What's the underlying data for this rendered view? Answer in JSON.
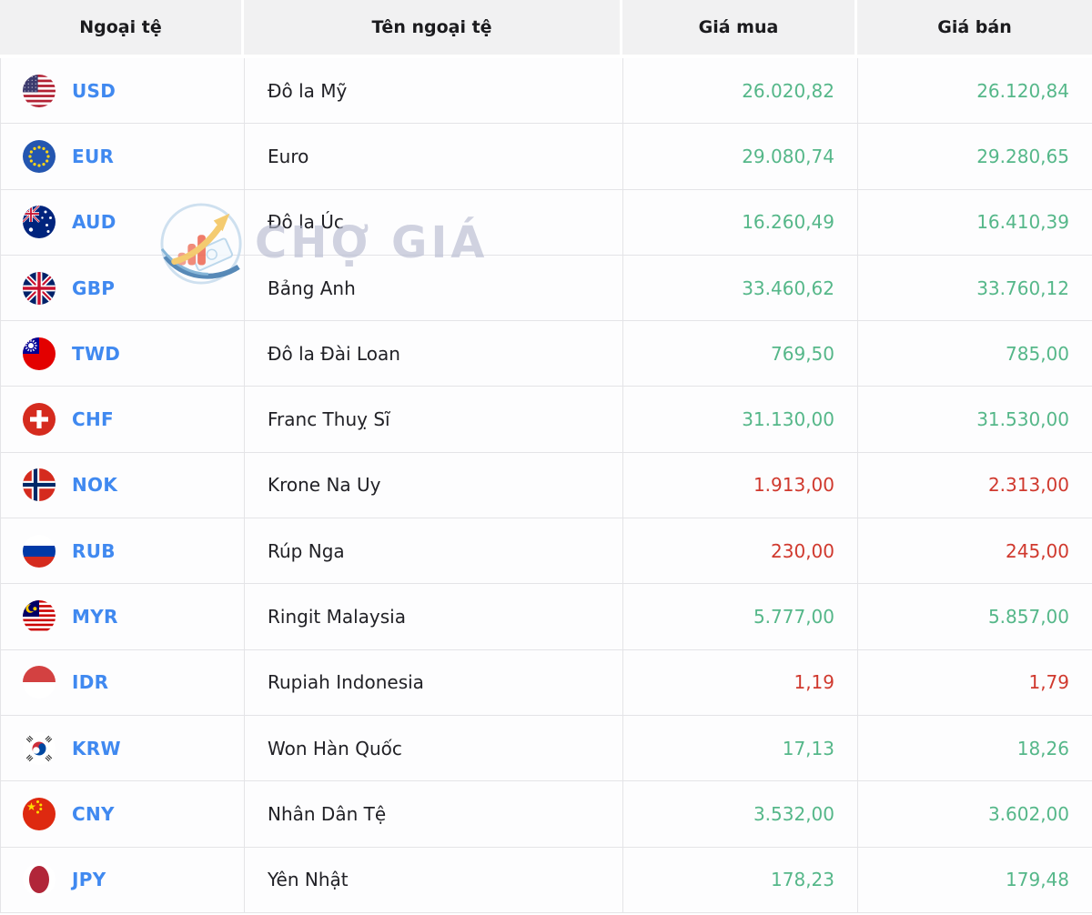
{
  "header": {
    "columns": [
      {
        "label": "Ngoại tệ"
      },
      {
        "label": "Tên ngoại tệ"
      },
      {
        "label": "Giá mua"
      },
      {
        "label": "Giá bán"
      }
    ]
  },
  "watermark": {
    "text": "CHỢ GIÁ",
    "logo_icon": "cho-gia-logo-icon"
  },
  "colors": {
    "header_bg": "#f1f1f2",
    "header_text": "#1b1b1e",
    "row_bg": "#fdfdfe",
    "border": "#e4e4e7",
    "code_blue": "#4089f0",
    "name_text": "#212126",
    "price_up": "#55b789",
    "price_down": "#d0392e",
    "watermark_text": "#b5b9cf"
  },
  "rows": [
    {
      "code": "USD",
      "name": "Đô la Mỹ",
      "flag_icon": "usd-flag-icon",
      "buy": "26.020,82",
      "sell": "26.120,84",
      "trend": "up"
    },
    {
      "code": "EUR",
      "name": "Euro",
      "flag_icon": "eur-flag-icon",
      "buy": "29.080,74",
      "sell": "29.280,65",
      "trend": "up"
    },
    {
      "code": "AUD",
      "name": "Đô la Úc",
      "flag_icon": "aud-flag-icon",
      "buy": "16.260,49",
      "sell": "16.410,39",
      "trend": "up"
    },
    {
      "code": "GBP",
      "name": "Bảng Anh",
      "flag_icon": "gbp-flag-icon",
      "buy": "33.460,62",
      "sell": "33.760,12",
      "trend": "up"
    },
    {
      "code": "TWD",
      "name": "Đô la Đài Loan",
      "flag_icon": "twd-flag-icon",
      "buy": "769,50",
      "sell": "785,00",
      "trend": "up"
    },
    {
      "code": "CHF",
      "name": "Franc Thuỵ Sĩ",
      "flag_icon": "chf-flag-icon",
      "buy": "31.130,00",
      "sell": "31.530,00",
      "trend": "up"
    },
    {
      "code": "NOK",
      "name": "Krone Na Uy",
      "flag_icon": "nok-flag-icon",
      "buy": "1.913,00",
      "sell": "2.313,00",
      "trend": "down"
    },
    {
      "code": "RUB",
      "name": "Rúp Nga",
      "flag_icon": "rub-flag-icon",
      "buy": "230,00",
      "sell": "245,00",
      "trend": "down"
    },
    {
      "code": "MYR",
      "name": "Ringit Malaysia",
      "flag_icon": "myr-flag-icon",
      "buy": "5.777,00",
      "sell": "5.857,00",
      "trend": "up"
    },
    {
      "code": "IDR",
      "name": "Rupiah Indonesia",
      "flag_icon": "idr-flag-icon",
      "buy": "1,19",
      "sell": "1,79",
      "trend": "down"
    },
    {
      "code": "KRW",
      "name": "Won Hàn Quốc",
      "flag_icon": "krw-flag-icon",
      "buy": "17,13",
      "sell": "18,26",
      "trend": "up"
    },
    {
      "code": "CNY",
      "name": "Nhân Dân Tệ",
      "flag_icon": "cny-flag-icon",
      "buy": "3.532,00",
      "sell": "3.602,00",
      "trend": "up"
    },
    {
      "code": "JPY",
      "name": "Yên Nhật",
      "flag_icon": "jpy-flag-icon",
      "buy": "178,23",
      "sell": "179,48",
      "trend": "up"
    }
  ]
}
